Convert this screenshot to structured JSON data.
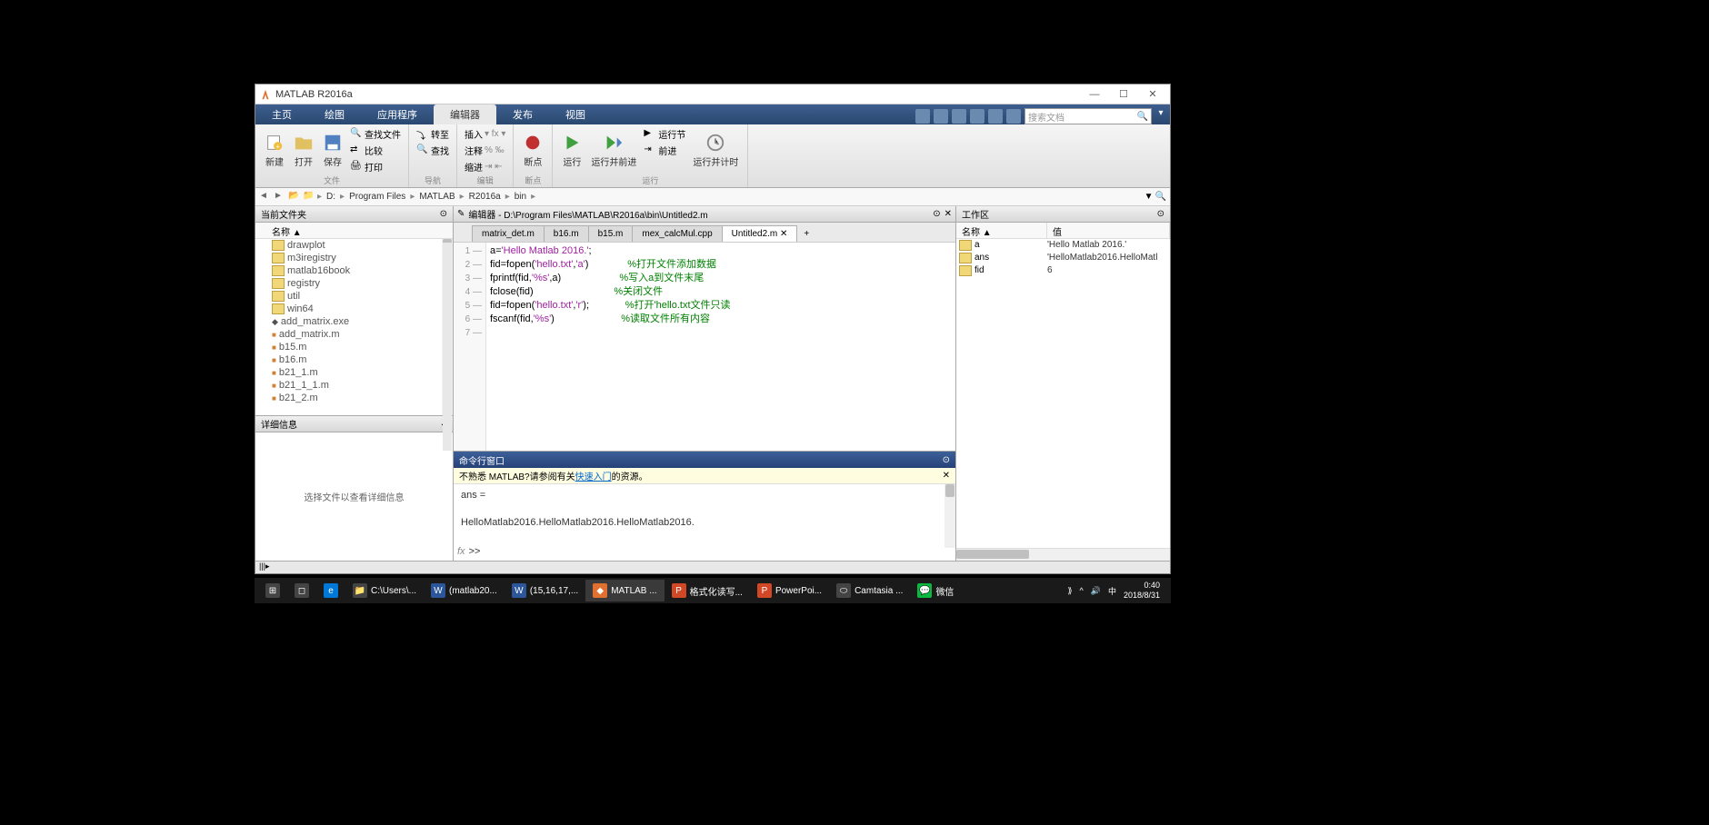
{
  "window": {
    "title": "MATLAB R2016a"
  },
  "tabs": {
    "home": "主页",
    "plots": "绘图",
    "apps": "应用程序",
    "editor": "编辑器",
    "publish": "发布",
    "view": "视图"
  },
  "search": {
    "placeholder": "搜索文档"
  },
  "toolstrip": {
    "new": "新建",
    "open": "打开",
    "save": "保存",
    "findfiles": "查找文件",
    "compare": "比较",
    "print": "打印",
    "goto": "转至",
    "find": "查找",
    "insert": "插入",
    "comment": "注释",
    "indent": "缩进",
    "breakpoints": "断点",
    "run": "运行",
    "runadvance": "运行并前进",
    "runsection": "运行节",
    "advance": "前进",
    "runtime": "运行并计时",
    "group_file": "文件",
    "group_nav": "导航",
    "group_edit": "编辑",
    "group_bp": "断点",
    "group_run": "运行"
  },
  "address": {
    "drive": "D:",
    "seg1": "Program Files",
    "seg2": "MATLAB",
    "seg3": "R2016a",
    "seg4": "bin"
  },
  "currentFolder": {
    "title": "当前文件夹",
    "name_col": "名称 ▲",
    "items": [
      {
        "name": "drawplot",
        "type": "folder"
      },
      {
        "name": "m3iregistry",
        "type": "folder"
      },
      {
        "name": "matlab16book",
        "type": "folder"
      },
      {
        "name": "registry",
        "type": "folder"
      },
      {
        "name": "util",
        "type": "folder"
      },
      {
        "name": "win64",
        "type": "folder"
      },
      {
        "name": "add_matrix.exe",
        "type": "exe"
      },
      {
        "name": "add_matrix.m",
        "type": "mfile"
      },
      {
        "name": "b15.m",
        "type": "mfile"
      },
      {
        "name": "b16.m",
        "type": "mfile"
      },
      {
        "name": "b21_1.m",
        "type": "mfile"
      },
      {
        "name": "b21_1_1.m",
        "type": "mfile"
      },
      {
        "name": "b21_2.m",
        "type": "mfile"
      }
    ]
  },
  "details": {
    "title": "详细信息",
    "placeholder": "选择文件以查看详细信息"
  },
  "editor": {
    "title": "编辑器 - D:\\Program Files\\MATLAB\\R2016a\\bin\\Untitled2.m",
    "tabs": [
      {
        "label": "matrix_det.m",
        "active": false
      },
      {
        "label": "b16.m",
        "active": false
      },
      {
        "label": "b15.m",
        "active": false
      },
      {
        "label": "mex_calcMul.cpp",
        "active": false
      },
      {
        "label": "Untitled2.m",
        "active": true
      }
    ],
    "code": [
      {
        "n": "1",
        "text_a": "a=",
        "text_b": "'Hello Matlab 2016.'",
        "text_c": ";"
      },
      {
        "n": "2",
        "text_a": "fid=fopen(",
        "text_b": "'hello.txt'",
        "text_c": ",",
        "text_d": "'a'",
        "text_e": ")",
        "cmt": "%打开文件添加数据"
      },
      {
        "n": "3",
        "text_a": "fprintf(fid,",
        "text_b": "'%s'",
        "text_c": ",a)",
        "cmt": "%写入a到文件末尾"
      },
      {
        "n": "4",
        "text_a": "fclose(fid)",
        "cmt": "%关闭文件"
      },
      {
        "n": "5",
        "text_a": "fid=fopen(",
        "text_b": "'hello.txt'",
        "text_c": ",",
        "text_d": "'r'",
        "text_e": ");",
        "cmt": "%打开'hello.txt文件只读"
      },
      {
        "n": "6",
        "text_a": "fscanf(fid,",
        "text_b": "'%s'",
        "text_c": ")",
        "cmt": "%读取文件所有内容"
      },
      {
        "n": "7",
        "text_a": ""
      }
    ]
  },
  "command": {
    "title": "命令行窗口",
    "banner_pre": "不熟悉 MATLAB?请参阅有关",
    "banner_link": "快速入门",
    "banner_post": "的资源。",
    "line1": "ans =",
    "line2": "HelloMatlab2016.HelloMatlab2016.HelloMatlab2016.",
    "prompt": ">>"
  },
  "workspace": {
    "title": "工作区",
    "col_name": "名称 ▲",
    "col_val": "值",
    "rows": [
      {
        "name": "a",
        "val": "'Hello Matlab 2016.'"
      },
      {
        "name": "ans",
        "val": "'HelloMatlab2016.HelloMatl"
      },
      {
        "name": "fid",
        "val": "6"
      }
    ]
  },
  "taskbar": {
    "items": [
      {
        "label": "",
        "icon": "win"
      },
      {
        "label": "",
        "icon": "task"
      },
      {
        "label": "",
        "icon": "edge"
      },
      {
        "label": "C:\\Users\\...",
        "icon": "explorer"
      },
      {
        "label": "(matlab20...",
        "icon": "word"
      },
      {
        "label": "(15,16,17,...",
        "icon": "word"
      },
      {
        "label": "MATLAB ...",
        "icon": "matlab",
        "active": true
      },
      {
        "label": "格式化读写...",
        "icon": "ppt"
      },
      {
        "label": "PowerPoi...",
        "icon": "ppt"
      },
      {
        "label": "Camtasia ...",
        "icon": "camtasia"
      },
      {
        "label": "微信",
        "icon": "wechat"
      }
    ],
    "time": "0:40",
    "date": "2018/8/31"
  }
}
